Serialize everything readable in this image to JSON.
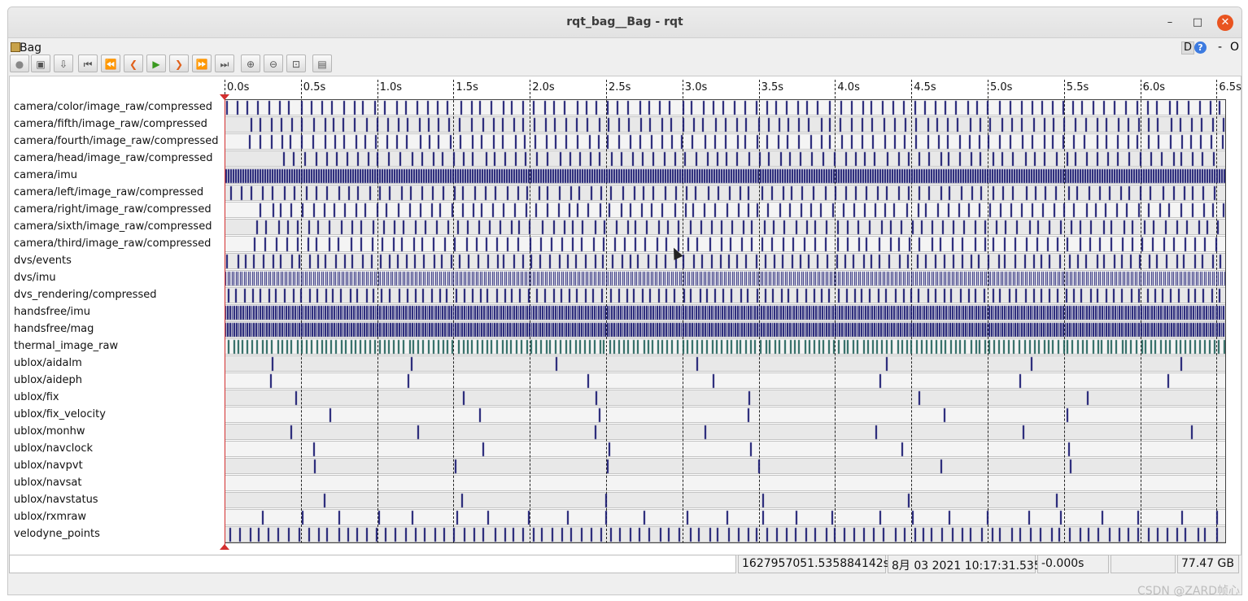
{
  "window": {
    "title": "rqt_bag__Bag - rqt",
    "minimize": "–",
    "maximize": "□",
    "close": "✕"
  },
  "plugin": {
    "name": "Bag",
    "d_label": "D",
    "help_label": "?",
    "dash": "-",
    "o_label": "O"
  },
  "toolbar": [
    {
      "name": "record-button",
      "glyph": "●"
    },
    {
      "name": "open-button",
      "glyph": "▣"
    },
    {
      "name": "save-button",
      "glyph": "⇩"
    },
    {
      "name": "go-start-button",
      "glyph": "⏮"
    },
    {
      "name": "rewind-button",
      "glyph": "⏪"
    },
    {
      "name": "step-back-button",
      "glyph": "❮"
    },
    {
      "name": "play-button",
      "glyph": "▶"
    },
    {
      "name": "step-forward-button",
      "glyph": "❯"
    },
    {
      "name": "fast-forward-button",
      "glyph": "⏩"
    },
    {
      "name": "go-end-button",
      "glyph": "⏭"
    },
    {
      "name": "zoom-in-button",
      "glyph": "⊕"
    },
    {
      "name": "zoom-out-button",
      "glyph": "⊖"
    },
    {
      "name": "zoom-reset-button",
      "glyph": "⊡"
    },
    {
      "name": "thumbnails-button",
      "glyph": "▤"
    }
  ],
  "timeline": {
    "ticks": [
      "0.0s",
      "0.5s",
      "1.0s",
      "1.5s",
      "2.0s",
      "2.5s",
      "3.0s",
      "3.5s",
      "4.0s",
      "4.5s",
      "5.0s",
      "5.5s",
      "6.0s",
      "6.5s"
    ],
    "topics": [
      "camera/color/image_raw/compressed",
      "camera/fifth/image_raw/compressed",
      "camera/fourth/image_raw/compressed",
      "camera/head/image_raw/compressed",
      "camera/imu",
      "camera/left/image_raw/compressed",
      "camera/right/image_raw/compressed",
      "camera/sixth/image_raw/compressed",
      "camera/third/image_raw/compressed",
      "dvs/events",
      "dvs/imu",
      "dvs_rendering/compressed",
      "handsfree/imu",
      "handsfree/mag",
      "thermal_image_raw",
      "ublox/aidalm",
      "ublox/aideph",
      "ublox/fix",
      "ublox/fix_velocity",
      "ublox/monhw",
      "ublox/navclock",
      "ublox/navpvt",
      "ublox/navsat",
      "ublox/navstatus",
      "ublox/rxmraw",
      "velodyne_points"
    ],
    "colors": {
      "message": "#14146e",
      "thermal": "#1f5f58",
      "playhead": "#d32f2f"
    }
  },
  "status": {
    "input_value": "",
    "stamp": "1627957051.535884142s",
    "datetime": "8月 03 2021 10:17:31.535",
    "elapsed": "-0.000s",
    "blank": "",
    "size": "77.47 GB"
  },
  "watermark": "CSDN @ZARD帧心"
}
